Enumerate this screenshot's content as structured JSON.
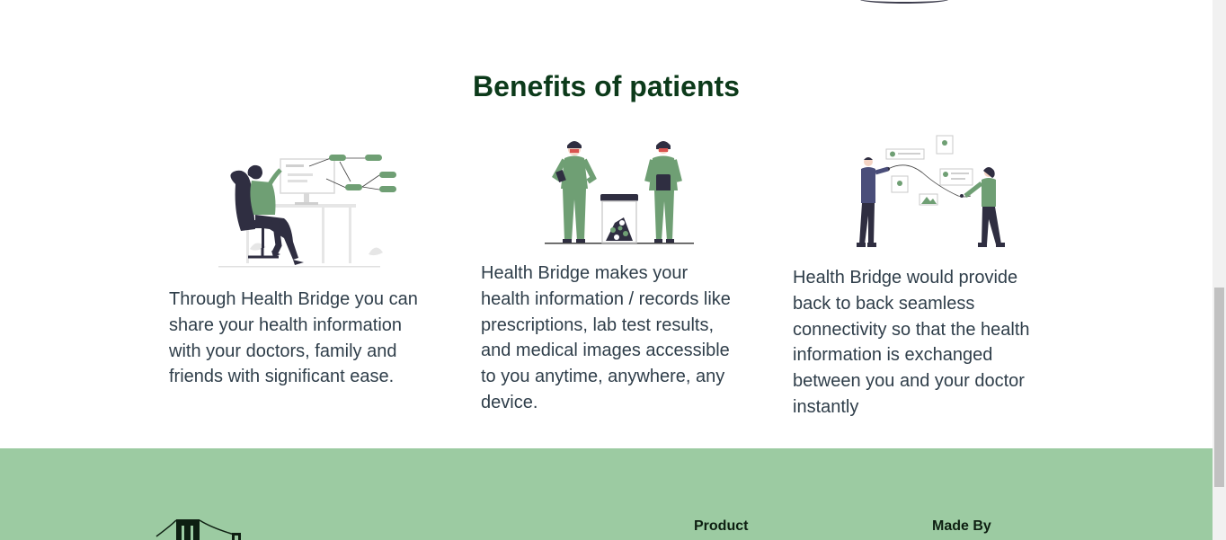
{
  "benefits": {
    "title": "Benefits of patients",
    "cards": [
      {
        "text": "Through Health Bridge you can share your health information with your doctors, family and friends with significant ease.",
        "illustration": "person-at-computer-illustration"
      },
      {
        "text": "Health Bridge makes your health information / records like prescriptions, lab test results, and medical images accessible to you anytime, anywhere, any device.",
        "illustration": "doctors-with-pills-illustration"
      },
      {
        "text": "Health Bridge would provide back to back seamless connectivity so that the health information is exchanged between you and your doctor instantly",
        "illustration": "connected-people-illustration"
      }
    ]
  },
  "footer": {
    "logo": "bridge-logo",
    "product_heading": "Product",
    "made_by_heading": "Made By"
  },
  "colors": {
    "accent_green": "#6f9f74",
    "footer_bg": "#9ccba2",
    "title_color": "#0c3a1a",
    "figure_dark": "#2f2e41"
  }
}
